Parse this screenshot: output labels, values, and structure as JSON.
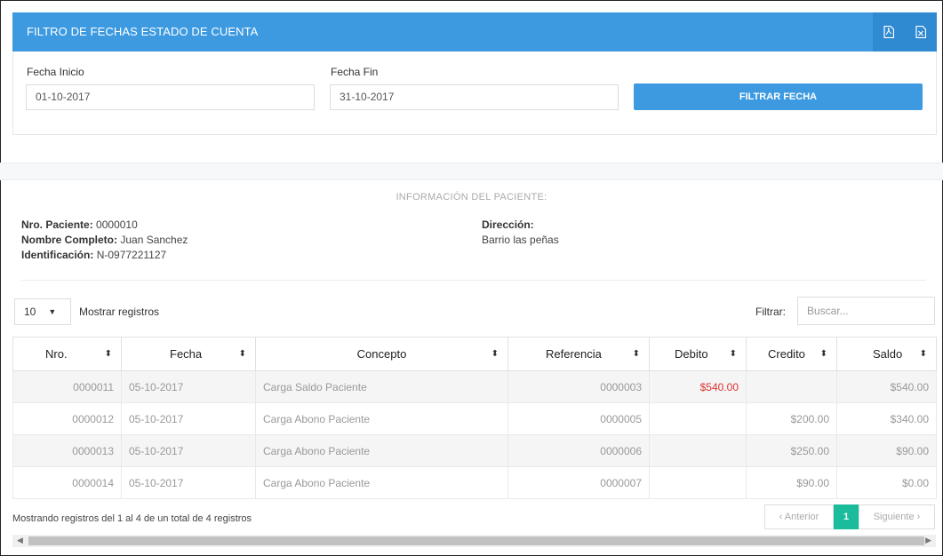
{
  "header": {
    "title": "FILTRO DE FECHAS ESTADO DE CUENTA",
    "pdf_icon": "pdf-file-icon",
    "excel_icon": "excel-file-icon",
    "color": "#3d9ae0"
  },
  "filter": {
    "start_label": "Fecha Inicio",
    "start_value": "01-10-2017",
    "end_label": "Fecha Fin",
    "end_value": "31-10-2017",
    "button_label": "FILTRAR FECHA"
  },
  "patient": {
    "section_title": "INFORMACIÓN DEL PACIENTE:",
    "nro_label": "Nro. Paciente:",
    "nro_value": "0000010",
    "name_label": "Nombre Completo:",
    "name_value": "Juan Sanchez",
    "id_label": "Identificación:",
    "id_value": "N-0977221127",
    "address_label": "Dirección:",
    "address_value": "Barrio las peñas"
  },
  "controls": {
    "page_length": "10",
    "show_label": "Mostrar registros",
    "filter_label": "Filtrar:",
    "search_placeholder": "Buscar..."
  },
  "table": {
    "headers": [
      "Nro.",
      "Fecha",
      "Concepto",
      "Referencia",
      "Debito",
      "Credito",
      "Saldo"
    ],
    "rows": [
      {
        "nro": "0000011",
        "fecha": "05-10-2017",
        "concepto": "Carga Saldo Paciente",
        "referencia": "0000003",
        "debito": "$540.00",
        "credito": "",
        "saldo": "$540.00"
      },
      {
        "nro": "0000012",
        "fecha": "05-10-2017",
        "concepto": "Carga Abono Paciente",
        "referencia": "0000005",
        "debito": "",
        "credito": "$200.00",
        "saldo": "$340.00"
      },
      {
        "nro": "0000013",
        "fecha": "05-10-2017",
        "concepto": "Carga Abono Paciente",
        "referencia": "0000006",
        "debito": "",
        "credito": "$250.00",
        "saldo": "$90.00"
      },
      {
        "nro": "0000014",
        "fecha": "05-10-2017",
        "concepto": "Carga Abono Paciente",
        "referencia": "0000007",
        "debito": "",
        "credito": "$90.00",
        "saldo": "$0.00"
      }
    ]
  },
  "footer": {
    "info": "Mostrando registros del 1 al 4 de un total de 4 registros",
    "prev_label": "‹ Anterior",
    "current_page": "1",
    "next_label": "Siguiente ›"
  }
}
